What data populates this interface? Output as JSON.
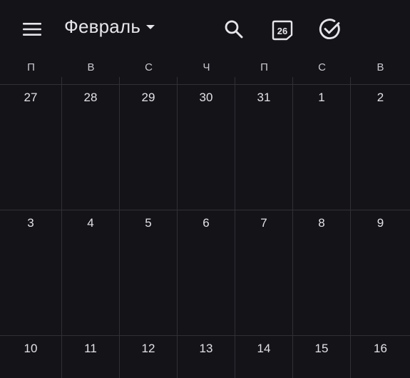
{
  "header": {
    "month": "Февраль",
    "menu_icon": "hamburger-menu-icon",
    "search_icon": "search-icon",
    "today_icon": "calendar-today-icon",
    "today_date": "26",
    "tasks_icon": "check-circle-icon"
  },
  "weekdays": [
    "П",
    "В",
    "С",
    "Ч",
    "П",
    "С",
    "В"
  ],
  "weeks": [
    [
      "27",
      "28",
      "29",
      "30",
      "31",
      "1",
      "2"
    ],
    [
      "3",
      "4",
      "5",
      "6",
      "7",
      "8",
      "9"
    ],
    [
      "10",
      "11",
      "12",
      "13",
      "14",
      "15",
      "16"
    ]
  ],
  "colors": {
    "background": "#131318",
    "text": "#e3e3e8",
    "gridline": "#303036"
  }
}
